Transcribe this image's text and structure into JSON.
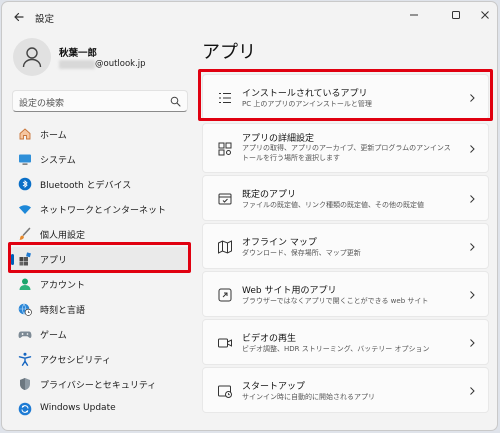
{
  "window": {
    "title": "設定",
    "back_icon": "arrow-left-icon",
    "controls": [
      "minimize-icon",
      "maximize-icon",
      "close-icon"
    ]
  },
  "profile": {
    "name": "秋葉一郎",
    "email_suffix": "@outlook.jp",
    "avatar_icon": "person-icon"
  },
  "search": {
    "placeholder": "設定の検索",
    "icon": "search-icon"
  },
  "nav": {
    "items": [
      {
        "label": "ホーム",
        "icon": "home-icon",
        "selected": false
      },
      {
        "label": "システム",
        "icon": "monitor-icon",
        "selected": false
      },
      {
        "label": "Bluetooth とデバイス",
        "icon": "bluetooth-icon",
        "selected": false
      },
      {
        "label": "ネットワークとインターネット",
        "icon": "wifi-icon",
        "selected": false
      },
      {
        "label": "個人用設定",
        "icon": "brush-icon",
        "selected": false
      },
      {
        "label": "アプリ",
        "icon": "apps-icon",
        "selected": true
      },
      {
        "label": "アカウント",
        "icon": "account-icon",
        "selected": false
      },
      {
        "label": "時刻と言語",
        "icon": "globe-clock-icon",
        "selected": false
      },
      {
        "label": "ゲーム",
        "icon": "gamepad-icon",
        "selected": false
      },
      {
        "label": "アクセシビリティ",
        "icon": "accessibility-icon",
        "selected": false
      },
      {
        "label": "プライバシーとセキュリティ",
        "icon": "shield-icon",
        "selected": false
      },
      {
        "label": "Windows Update",
        "icon": "update-icon",
        "selected": false
      }
    ]
  },
  "main": {
    "title": "アプリ",
    "cards": [
      {
        "title": "インストールされているアプリ",
        "desc": "PC 上のアプリのアンインストールと管理",
        "icon": "list-icon"
      },
      {
        "title": "アプリの詳細設定",
        "desc": "アプリの取得、アプリのアーカイブ、更新プログラムのアンインストールを行う場所を選択します",
        "icon": "app-settings-icon"
      },
      {
        "title": "既定のアプリ",
        "desc": "ファイルの既定値、リンク種類の既定値、その他の既定値",
        "icon": "default-apps-icon"
      },
      {
        "title": "オフライン マップ",
        "desc": "ダウンロード、保存場所、マップ更新",
        "icon": "map-icon"
      },
      {
        "title": "Web サイト用のアプリ",
        "desc": "ブラウザーではなくアプリで開くことができる web サイト",
        "icon": "web-app-icon"
      },
      {
        "title": "ビデオの再生",
        "desc": "ビデオ調整、HDR ストリーミング、バッテリー オプション",
        "icon": "video-icon"
      },
      {
        "title": "スタートアップ",
        "desc": "サインイン時に自動的に開始されるアプリ",
        "icon": "startup-icon"
      }
    ]
  },
  "colors": {
    "accent": "#005fb8",
    "highlight_red": "#e00010",
    "window_bg": "#f3f3f3",
    "card_bg": "#fbfbfb"
  }
}
